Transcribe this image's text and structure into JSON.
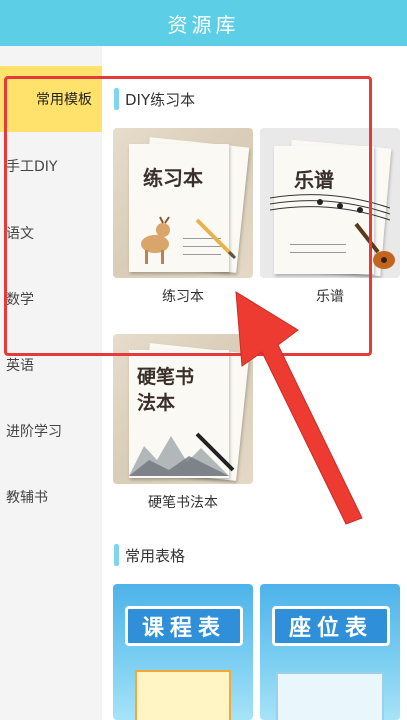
{
  "header": {
    "title": "资源库"
  },
  "sidebar": {
    "items": [
      {
        "label": "常用模板",
        "active": true
      },
      {
        "label": "手工DIY",
        "active": false
      },
      {
        "label": "语文",
        "active": false
      },
      {
        "label": "数学",
        "active": false
      },
      {
        "label": "英语",
        "active": false
      },
      {
        "label": "进阶学习",
        "active": false
      },
      {
        "label": "教辅书",
        "active": false
      }
    ]
  },
  "sections": [
    {
      "title": "DIY练习本",
      "cards": [
        {
          "label": "练习本",
          "cover_text": "练习本"
        },
        {
          "label": "乐谱",
          "cover_text": "乐谱"
        },
        {
          "label": "硬笔书法本",
          "cover_text": "硬笔书法本"
        }
      ]
    },
    {
      "title": "常用表格",
      "cards": [
        {
          "label": "",
          "cover_text": "课程表"
        },
        {
          "label": "",
          "cover_text": "座位表"
        }
      ]
    }
  ],
  "colors": {
    "header_bg": "#5ccfe6",
    "active_item_bg": "#ffe26b",
    "highlight": "#e53a3a",
    "section_accent": "#7fd6ea"
  }
}
